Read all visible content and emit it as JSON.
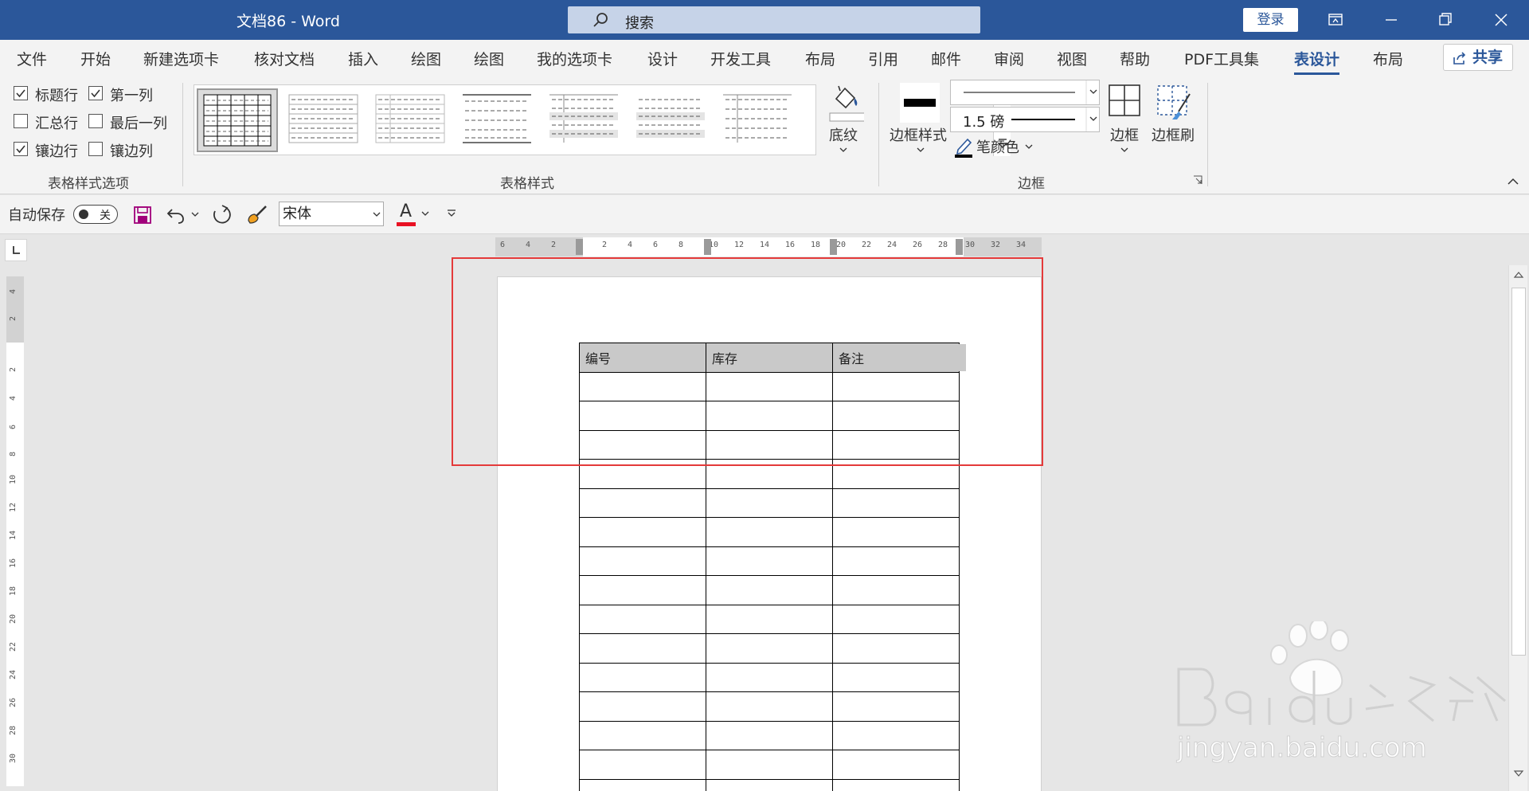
{
  "titlebar": {
    "title": "文档86  -  Word",
    "search_placeholder": "搜索",
    "login": "登录"
  },
  "tabs": [
    "文件",
    "开始",
    "新建选项卡",
    "核对文档",
    "插入",
    "绘图",
    "绘图",
    "我的选项卡",
    "设计",
    "开发工具",
    "布局",
    "引用",
    "邮件",
    "审阅",
    "视图",
    "帮助",
    "PDF工具集",
    "表设计",
    "布局"
  ],
  "active_tab": "表设计",
  "share": "共享",
  "ribbon": {
    "style_options": {
      "header_row": "标题行",
      "first_column": "第一列",
      "total_row": "汇总行",
      "last_column": "最后一列",
      "banded_rows": "镶边行",
      "banded_columns": "镶边列",
      "group_label": "表格样式选项"
    },
    "table_styles": {
      "group_label": "表格样式",
      "shading": "底纹"
    },
    "borders": {
      "border_styles": "边框样式",
      "line_weight": "1.5 磅",
      "pen_color": "笔颜色",
      "borders_btn": "边框",
      "border_painter": "边框刷",
      "group_label": "边框"
    }
  },
  "qat": {
    "autosave": "自动保存",
    "toggle_state": "关",
    "font": "宋体",
    "font_color_letter": "A"
  },
  "ruler": {
    "h_ticks": [
      "6",
      "4",
      "2",
      "2",
      "4",
      "6",
      "8",
      "10",
      "12",
      "14",
      "16",
      "18",
      "20",
      "22",
      "24",
      "26",
      "28",
      "30",
      "32",
      "34"
    ],
    "v_ticks": [
      "4",
      "2",
      "2",
      "4",
      "6",
      "8",
      "10",
      "12",
      "14",
      "16",
      "18",
      "20",
      "22",
      "24",
      "26",
      "28",
      "30"
    ]
  },
  "table": {
    "headers": [
      "编号",
      "库存",
      "备注"
    ],
    "empty_rows": 15
  },
  "colors": {
    "brand": "#2b579a",
    "annotation": "#e43a3a",
    "font_color": "#e81123"
  }
}
